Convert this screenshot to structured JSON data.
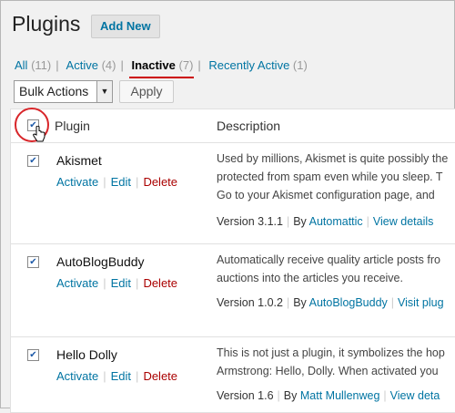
{
  "header": {
    "title": "Plugins",
    "add_new": "Add New"
  },
  "filters": {
    "all": {
      "label": "All",
      "count": "(11)"
    },
    "active": {
      "label": "Active",
      "count": "(4)"
    },
    "inactive": {
      "label": "Inactive",
      "count": "(7)"
    },
    "recent": {
      "label": "Recently Active",
      "count": "(1)"
    },
    "separator": "|"
  },
  "bulk": {
    "selected": "Bulk Actions",
    "arrow": "▼",
    "apply": "Apply"
  },
  "table": {
    "col_plugin": "Plugin",
    "col_description": "Description"
  },
  "checkbox_mark": "✔",
  "action_labels": {
    "activate": "Activate",
    "edit": "Edit",
    "delete": "Delete",
    "sep": "|"
  },
  "plugins": [
    {
      "name": "Akismet",
      "description": [
        "Used by millions, Akismet is quite possibly the",
        "protected from spam even while you sleep. T",
        "Go to your Akismet configuration page, and"
      ],
      "version": "Version 3.1.1",
      "by": "By",
      "author": "Automattic",
      "details": "View details"
    },
    {
      "name": "AutoBlogBuddy",
      "description": [
        "Automatically receive quality article posts fro",
        "auctions into the articles you receive."
      ],
      "version": "Version 1.0.2",
      "by": "By",
      "author": "AutoBlogBuddy",
      "details": "Visit plug"
    },
    {
      "name": "Hello Dolly",
      "description": [
        "This is not just a plugin, it symbolizes the hop",
        "Armstrong: Hello, Dolly. When activated you"
      ],
      "version": "Version 1.6",
      "by": "By",
      "author": "Matt Mullenweg",
      "details": "View deta"
    }
  ]
}
